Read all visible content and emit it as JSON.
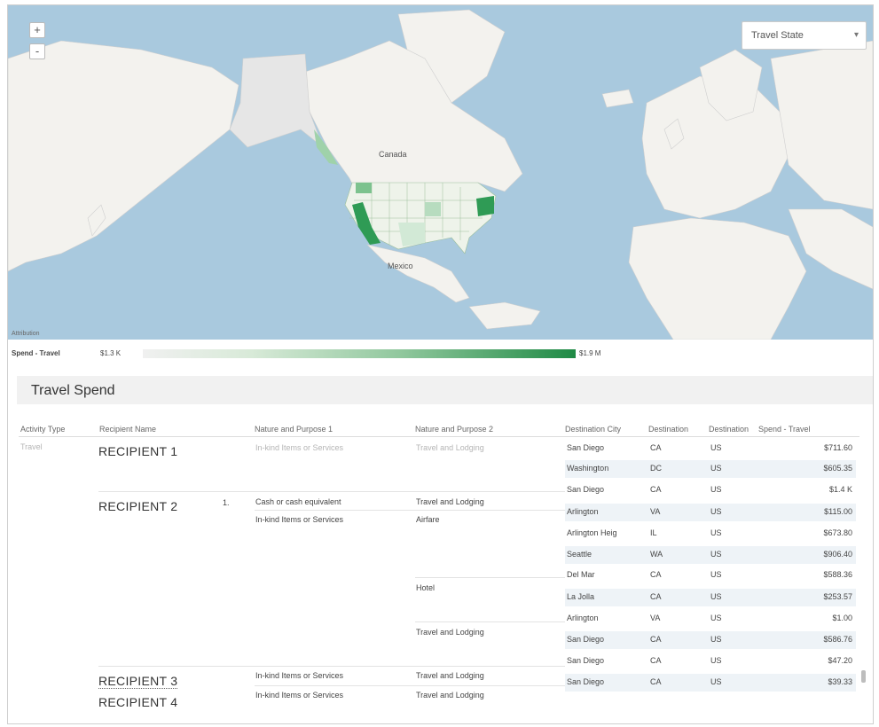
{
  "map": {
    "zoom_in": "+",
    "zoom_out": "-",
    "layer_select": "Travel State",
    "labels": {
      "canada": "Canada",
      "mexico": "Mexico"
    },
    "attribution": "Attribution"
  },
  "legend": {
    "title": "Spend - Travel",
    "min": "$1.3 K",
    "max": "$1.9 M",
    "color_low": "#f0f0f0",
    "color_high": "#1f8a45"
  },
  "section": {
    "title": "Travel Spend"
  },
  "table": {
    "headers": [
      "Activity Type",
      "Recipient Name",
      "Nature and Purpose 1",
      "Nature and Purpose 2",
      "Destination City",
      "Destination",
      "Destination",
      "Spend - Travel"
    ],
    "activity_type": "Travel",
    "recipients": [
      "RECIPIENT 1",
      "RECIPIENT 2",
      "RECIPIENT 3",
      "RECIPIENT 4"
    ],
    "expand_marker": "1.",
    "purpose1": {
      "r1": "In-kind Items or Services",
      "r2a": "Cash or cash equivalent",
      "r2b": "In-kind Items or Services",
      "r3": "In-kind Items or Services",
      "r4": "In-kind Items or Services"
    },
    "purpose2": {
      "r1": "Travel and Lodging",
      "r2a": "Travel and Lodging",
      "r2b": "Airfare",
      "r2c": "Hotel",
      "r2d": "Travel and Lodging",
      "r3": "Travel and Lodging",
      "r4": "Travel and Lodging"
    },
    "rows": [
      {
        "city": "San Diego",
        "state": "CA",
        "country": "US",
        "spend": "$711.60"
      },
      {
        "city": "Washington",
        "state": "DC",
        "country": "US",
        "spend": "$605.35"
      },
      {
        "city": "San Diego",
        "state": "CA",
        "country": "US",
        "spend": "$1.4 K"
      },
      {
        "city": "Arlington",
        "state": "VA",
        "country": "US",
        "spend": "$115.00"
      },
      {
        "city": "Arlington Heig",
        "state": "IL",
        "country": "US",
        "spend": "$673.80"
      },
      {
        "city": "Seattle",
        "state": "WA",
        "country": "US",
        "spend": "$906.40"
      },
      {
        "city": "Del Mar",
        "state": "CA",
        "country": "US",
        "spend": "$588.36"
      },
      {
        "city": "La Jolla",
        "state": "CA",
        "country": "US",
        "spend": "$253.57"
      },
      {
        "city": "Arlington",
        "state": "VA",
        "country": "US",
        "spend": "$1.00"
      },
      {
        "city": "San Diego",
        "state": "CA",
        "country": "US",
        "spend": "$586.76"
      },
      {
        "city": "San Diego",
        "state": "CA",
        "country": "US",
        "spend": "$47.20"
      },
      {
        "city": "San Diego",
        "state": "CA",
        "country": "US",
        "spend": "$39.33"
      }
    ]
  }
}
